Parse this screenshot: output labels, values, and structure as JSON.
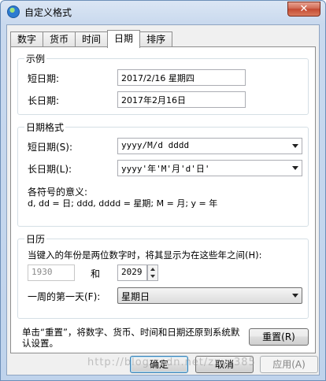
{
  "window": {
    "title": "自定义格式",
    "close_label": "✕"
  },
  "tabs": [
    {
      "label": "数字",
      "active": false
    },
    {
      "label": "货币",
      "active": false
    },
    {
      "label": "时间",
      "active": false
    },
    {
      "label": "日期",
      "active": true
    },
    {
      "label": "排序",
      "active": false
    }
  ],
  "example": {
    "legend": "示例",
    "short_label": "短日期:",
    "short_value": "2017/2/16 星期四",
    "long_label": "长日期:",
    "long_value": "2017年2月16日"
  },
  "date_format": {
    "legend": "日期格式",
    "short_label": "短日期(S):",
    "short_value": "yyyy/M/d dddd",
    "long_label": "长日期(L):",
    "long_value": "yyyy'年'M'月'd'日'",
    "symbols_title": "各符号的意义:",
    "symbols_desc": "d, dd = 日;  ddd, dddd = 星期;  M = 月;  y = 年"
  },
  "calendar": {
    "legend": "日历",
    "two_digit_desc": "当键入的年份是两位数字时，将其显示为在这些年之间(H):",
    "from_year": "1930",
    "and_label": "和",
    "to_year": "2029",
    "first_day_label": "一周的第一天(F):",
    "first_day_value": "星期日"
  },
  "reset": {
    "desc": "单击“重置”，将数字、货币、时间和日期还原到系统默认设置。",
    "button": "重置(R)"
  },
  "footer": {
    "ok": "确定",
    "cancel": "取消",
    "apply": "应用(A)"
  },
  "watermark": "http://blog.csdn.net/zxy_385"
}
